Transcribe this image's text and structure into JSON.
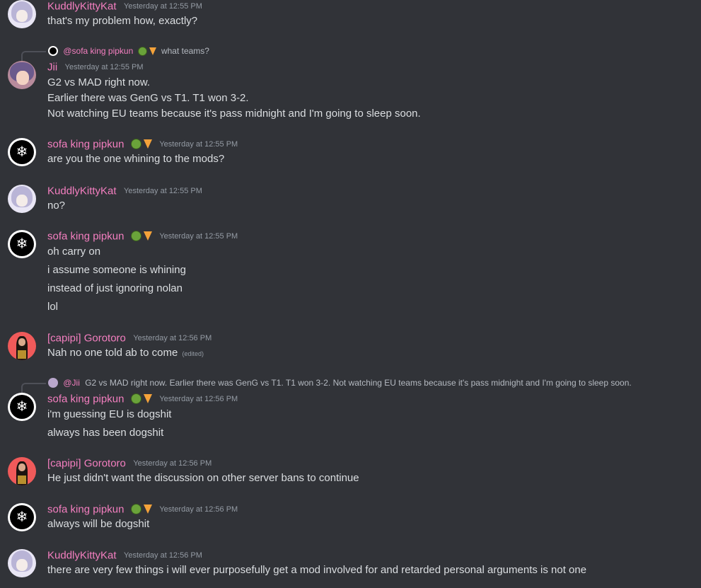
{
  "messages": [
    {
      "author": "KuddlyKittyKat",
      "timestamp": "Yesterday at 12:55 PM",
      "lines": [
        "that's my problem how, exactly?"
      ]
    },
    {
      "reply_to": {
        "author": "@sofa king pipkun",
        "text": "what teams?"
      },
      "author": "Jii",
      "timestamp": "Yesterday at 12:55 PM",
      "lines": [
        "G2 vs MAD right now.",
        "Earlier there was GenG vs T1. T1 won 3-2.",
        "Not watching EU teams because it's pass midnight and I'm going to sleep soon."
      ]
    },
    {
      "author": "sofa king pipkun",
      "timestamp": "Yesterday at 12:55 PM",
      "lines": [
        "are you the one whining to the mods?"
      ]
    },
    {
      "author": "KuddlyKittyKat",
      "timestamp": "Yesterday at 12:55 PM",
      "lines": [
        "no?"
      ]
    },
    {
      "author": "sofa king pipkun",
      "timestamp": "Yesterday at 12:55 PM",
      "lines": [
        "oh carry on",
        "i assume someone is whining",
        "instead of just ignoring nolan",
        "lol"
      ]
    },
    {
      "author": "[capipi] Gorotoro",
      "timestamp": "Yesterday at 12:56 PM",
      "lines": [
        "Nah no one told ab to come"
      ],
      "edited": "(edited)"
    },
    {
      "reply_to": {
        "author": "@Jii",
        "text": "G2 vs MAD right now. Earlier there was GenG vs T1. T1 won 3-2. Not watching EU teams because it's pass midnight and I'm going to sleep soon."
      },
      "author": "sofa king pipkun",
      "timestamp": "Yesterday at 12:56 PM",
      "lines": [
        "i'm guessing EU is dogshit",
        "always has been dogshit"
      ]
    },
    {
      "author": "[capipi] Gorotoro",
      "timestamp": "Yesterday at 12:56 PM",
      "lines": [
        "He just didn't want the discussion on other server bans to continue"
      ]
    },
    {
      "author": "sofa king pipkun",
      "timestamp": "Yesterday at 12:56 PM",
      "lines": [
        "always will be dogshit"
      ]
    },
    {
      "author": "KuddlyKittyKat",
      "timestamp": "Yesterday at 12:56 PM",
      "lines": [
        "there are very few things i will ever purposefully get a mod involved for and retarded personal arguments is not one"
      ]
    }
  ],
  "icons": {
    "sofa_avatar": "snowflake-icon",
    "badge_1": "kiwi-icon",
    "badge_2": "pizza-icon"
  },
  "glyphs": {
    "snowflake": "❄"
  },
  "colors": {
    "background": "#313338",
    "author_name": "#f47fc0",
    "timestamp": "#949ba4",
    "message_text": "#dbdee1"
  }
}
